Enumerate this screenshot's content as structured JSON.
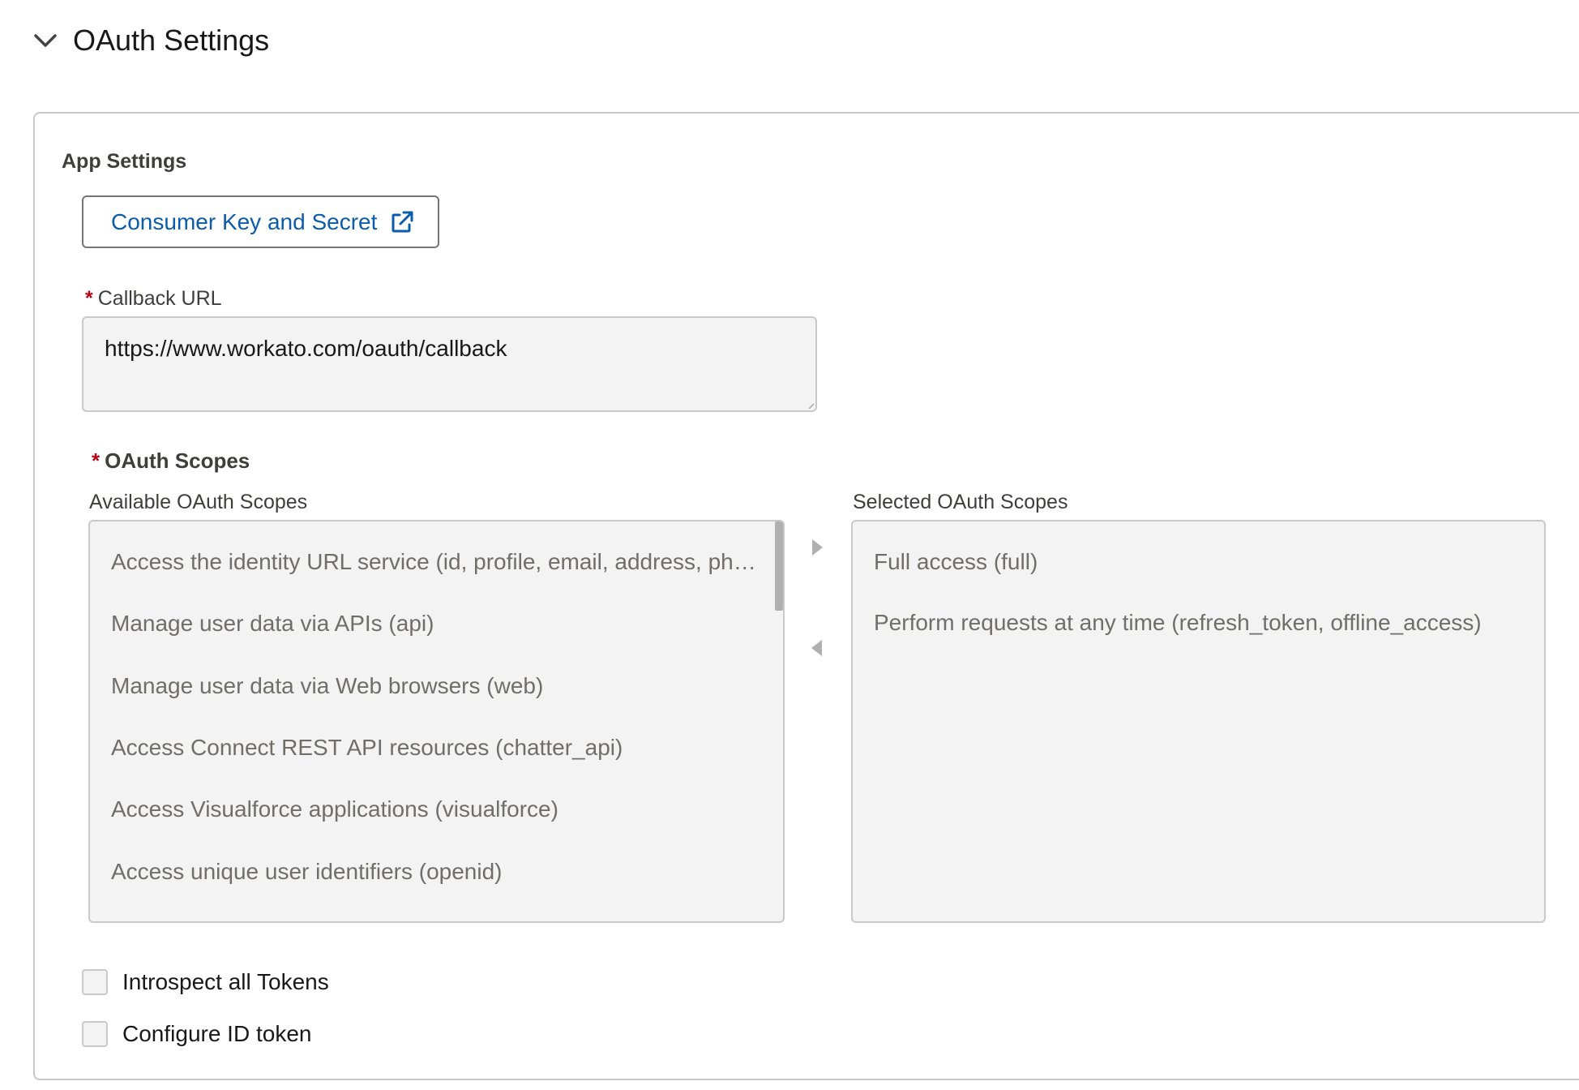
{
  "section": {
    "title": "OAuth Settings",
    "toggle_icon": "chevron-down-icon"
  },
  "app_settings": {
    "heading": "App Settings",
    "consumer_button_label": "Consumer Key and Secret",
    "consumer_button_icon": "external-link-icon"
  },
  "callback": {
    "required_marker": "*",
    "label": "Callback URL",
    "value": "https://www.workato.com/oauth/callback"
  },
  "scopes": {
    "required_marker": "*",
    "title": "OAuth Scopes",
    "available_label": "Available OAuth Scopes",
    "selected_label": "Selected OAuth Scopes",
    "available": [
      "Access the identity URL service (id, profile, email, address, phone)",
      "Manage user data via APIs (api)",
      "Manage user data via Web browsers (web)",
      "Access Connect REST API resources (chatter_api)",
      "Access Visualforce applications (visualforce)",
      "Access unique user identifiers (openid)"
    ],
    "selected": [
      "Full access (full)",
      "Perform requests at any time (refresh_token, offline_access)"
    ],
    "add_icon": "arrow-right-icon",
    "remove_icon": "arrow-left-icon"
  },
  "options": {
    "introspect_label": "Introspect all Tokens",
    "introspect_checked": false,
    "id_token_label": "Configure ID token",
    "id_token_checked": false
  },
  "colors": {
    "link": "#0b5cab",
    "required": "#ba0517",
    "field_bg": "#f3f3f3",
    "border": "#c9c9c9"
  }
}
